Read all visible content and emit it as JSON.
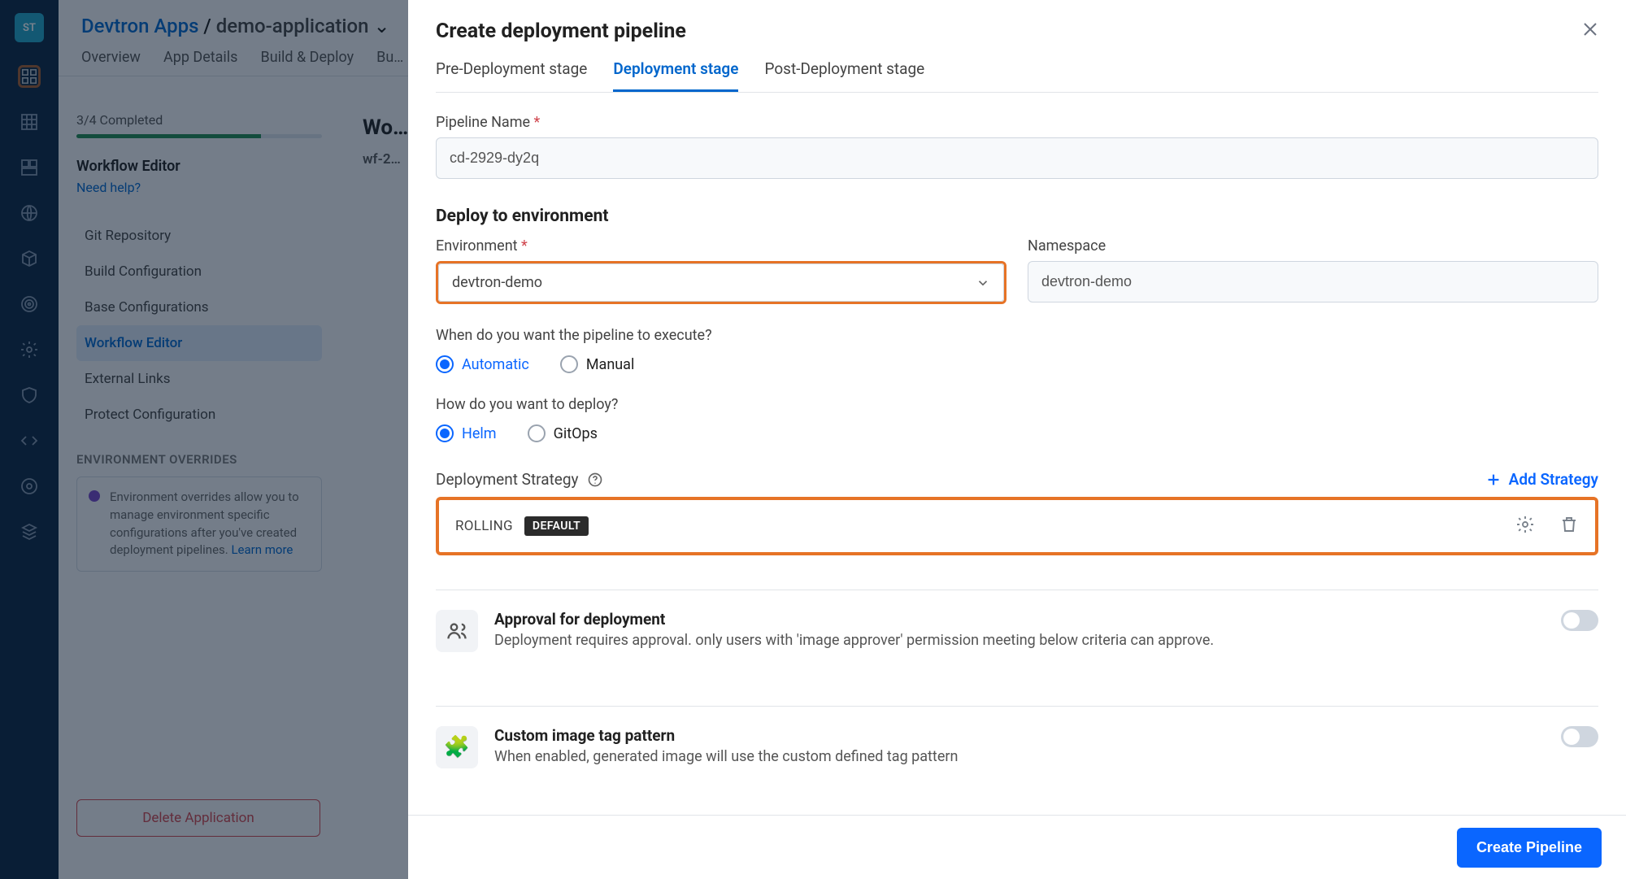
{
  "bg": {
    "crumb_root": "Devtron Apps",
    "crumb_sep": "/",
    "crumb_app": "demo-application",
    "tabs": [
      "Overview",
      "App Details",
      "Build & Deploy",
      "Bu…"
    ],
    "progress": "3/4 Completed",
    "left_title": "Workflow Editor",
    "help": "Need help?",
    "menu": {
      "git": "Git Repository",
      "build": "Build Configuration",
      "base": "Base Configurations",
      "wf": "Workflow Editor",
      "ext": "External Links",
      "prot": "Protect Configuration"
    },
    "env_ovr_h": "ENVIRONMENT OVERRIDES",
    "env_ovr_txt": "Environment overrides allow you to manage environment specific configurations after you've created deployment pipelines.",
    "env_ovr_link": "Learn more",
    "delete": "Delete Application",
    "right_h": "Wo…",
    "wf": "wf-2…"
  },
  "modal": {
    "title": "Create deployment pipeline",
    "tabs": {
      "pre": "Pre-Deployment stage",
      "dep": "Deployment stage",
      "post": "Post-Deployment stage"
    },
    "pipeline_name_lbl": "Pipeline Name",
    "pipeline_name_val": "cd-2929-dy2q",
    "deploy_env_h": "Deploy to environment",
    "env_lbl": "Environment",
    "env_val": "devtron-demo",
    "ns_lbl": "Namespace",
    "ns_val": "devtron-demo",
    "exec_q": "When do you want the pipeline to execute?",
    "exec_auto": "Automatic",
    "exec_manual": "Manual",
    "dep_q": "How do you want to deploy?",
    "dep_helm": "Helm",
    "dep_gitops": "GitOps",
    "ds_h": "Deployment Strategy",
    "add_strategy": "Add Strategy",
    "strategy_name": "ROLLING",
    "strategy_badge": "DEFAULT",
    "approval_title": "Approval for deployment",
    "approval_desc": "Deployment requires approval. only users with 'image approver' permission meeting below criteria can approve.",
    "tag_title": "Custom image tag pattern",
    "tag_desc": "When enabled, generated image will use the custom defined tag pattern",
    "create": "Create Pipeline"
  }
}
